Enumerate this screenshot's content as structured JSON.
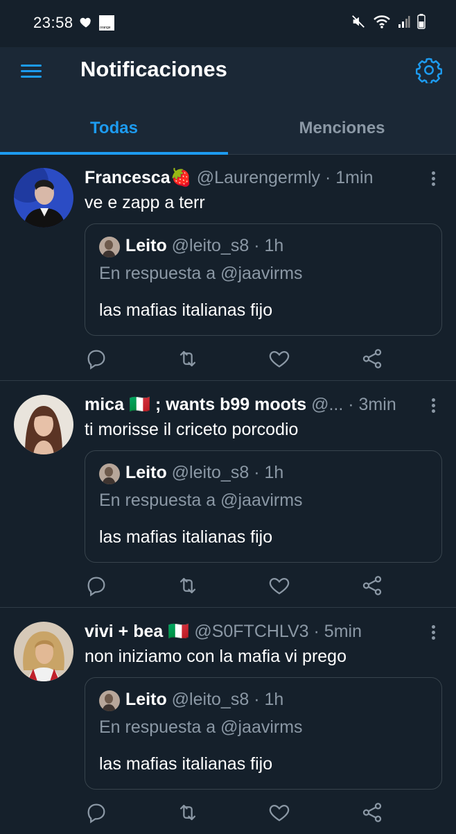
{
  "status_bar": {
    "time": "23:58",
    "carrier_logo_text": "orange",
    "icons": [
      "heart-icon",
      "orange-logo",
      "mute-icon",
      "wifi-icon",
      "signal-icon",
      "battery-icon"
    ]
  },
  "header": {
    "title": "Notificaciones",
    "icons": [
      "menu-icon",
      "settings-icon"
    ],
    "accent_color": "#1d9bf0"
  },
  "tabs": [
    {
      "label": "Todas",
      "active": true
    },
    {
      "label": "Menciones",
      "active": false
    }
  ],
  "notifications": [
    {
      "name": "Francesca",
      "emoji": "🍓",
      "handle": "@Laurengermly",
      "sep": "·",
      "time": "1min",
      "text": "ve e zapp a terr",
      "quote": {
        "name": "Leito",
        "handle": "@leito_s8",
        "sep": "·",
        "time": "1h",
        "reply_to": "En respuesta a @jaavirms",
        "text": "las mafias italianas fijo"
      }
    },
    {
      "name": "mica",
      "emoji": "🇮🇹",
      "name_suffix": "; wants b99 moots",
      "handle": "@...",
      "sep": "·",
      "time": "3min",
      "text": "ti morisse il criceto porcodio",
      "quote": {
        "name": "Leito",
        "handle": "@leito_s8",
        "sep": "·",
        "time": "1h",
        "reply_to": "En respuesta a @jaavirms",
        "text": "las mafias italianas fijo"
      }
    },
    {
      "name": "vivi + bea",
      "emoji": "🇮🇹",
      "handle": "@S0FTCHLV3",
      "sep": "·",
      "time": "5min",
      "text": "non iniziamo con la mafia vi prego",
      "quote": {
        "name": "Leito",
        "handle": "@leito_s8",
        "sep": "·",
        "time": "1h",
        "reply_to": "En respuesta a @jaavirms",
        "text": "las mafias italianas fijo"
      }
    }
  ],
  "action_icons": [
    "reply-icon",
    "retweet-icon",
    "like-icon",
    "share-icon"
  ],
  "colors": {
    "background": "#15202b",
    "header_background": "#1b2836",
    "muted_text": "#8b98a5",
    "border": "#38444d"
  }
}
